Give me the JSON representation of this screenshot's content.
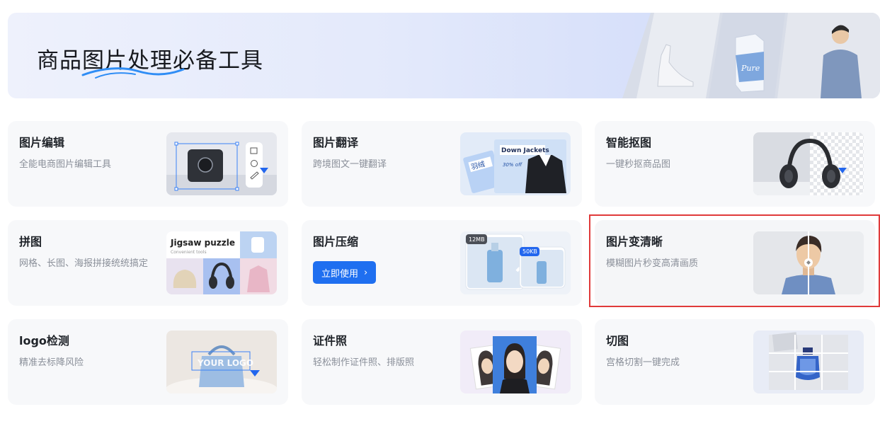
{
  "banner": {
    "title": "商品图片处理必备工具",
    "art_text_bottle": "Pure"
  },
  "cards": [
    {
      "title": "图片编辑",
      "desc": "全能电商图片编辑工具"
    },
    {
      "title": "图片翻译",
      "desc": "跨境图文一键翻译",
      "thumb_texts": {
        "headline": "Down Jackets",
        "price": "30% off",
        "tag": "羽绒"
      }
    },
    {
      "title": "智能抠图",
      "desc": "一键秒抠商品图"
    },
    {
      "title": "拼图",
      "desc": "网格、长图、海报拼接统统搞定",
      "thumb_texts": {
        "headline": "Jigsaw puzzle",
        "sub": "Convenient tools"
      }
    },
    {
      "title": "图片压缩",
      "button": "立即使用",
      "button_icon": "›",
      "thumb_texts": {
        "before": "12MB",
        "after": "50KB"
      }
    },
    {
      "title": "图片变清晰",
      "desc": "模糊图片秒变高清画质"
    },
    {
      "title": "logo检测",
      "desc": "精准去标降风险",
      "thumb_texts": {
        "watermark": "YOUR LOGO"
      }
    },
    {
      "title": "证件照",
      "desc": "轻松制作证件照、排版照"
    },
    {
      "title": "切图",
      "desc": "宫格切割一键完成"
    }
  ],
  "colors": {
    "accent": "#1f6ff0",
    "highlight_border": "#e03a3a",
    "card_bg": "#f7f8fa"
  }
}
